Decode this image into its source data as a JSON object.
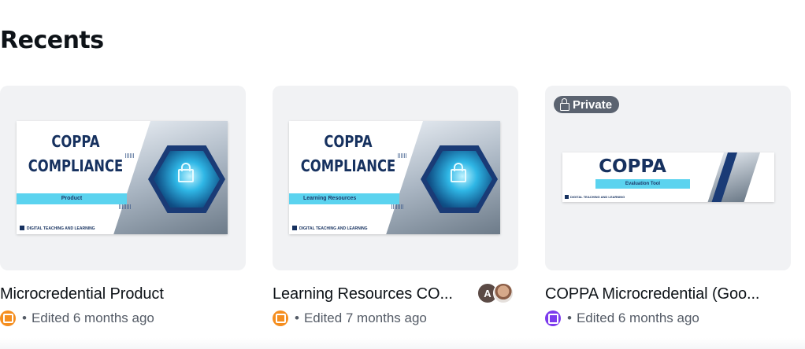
{
  "section_title": "Recents",
  "cards": [
    {
      "name": "Microcredential Product",
      "edited": "Edited 6 months ago",
      "separator": "•",
      "app_icon": "presentation-icon",
      "thumbnail": {
        "title_line1": "COPPA",
        "title_line2": "COMPLIANCE",
        "bar_label": "Product",
        "footer": "DIGITAL TEACHING AND LEARNING"
      }
    },
    {
      "name": "Learning Resources CO...",
      "edited": "Edited 7 months ago",
      "separator": "•",
      "app_icon": "presentation-icon",
      "collaborator_initial": "A",
      "thumbnail": {
        "title_line1": "COPPA",
        "title_line2": "COMPLIANCE",
        "bar_label": "Learning Resources",
        "footer": "DIGITAL TEACHING AND LEARNING"
      }
    },
    {
      "name": "COPPA Microcredential (Goo...",
      "edited": "Edited 6 months ago",
      "separator": "•",
      "app_icon": "doc-icon",
      "badge": "Private",
      "thumbnail": {
        "title": "COPPA",
        "bar_label": "Evaluation Tool",
        "footer": "DIGITAL TEACHING AND LEARNING"
      }
    }
  ],
  "colors": {
    "navy": "#16315f",
    "cyan": "#5bd3ef",
    "presentation_icon": "#f58e1f",
    "doc_icon": "#7c3aed",
    "badge_bg": "#5b6370"
  }
}
